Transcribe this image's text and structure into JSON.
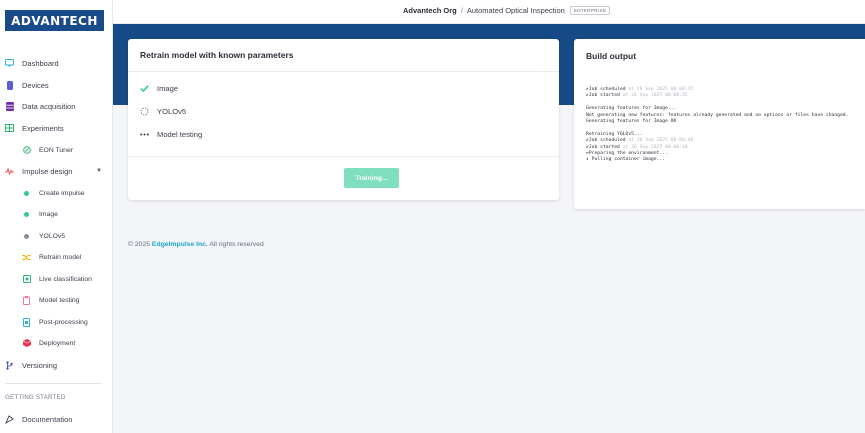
{
  "logo": {
    "text": "ADVANTECH"
  },
  "sidebar": {
    "items": [
      {
        "label": "Dashboard",
        "icon": "monitor-icon",
        "color": "#28b3d4"
      },
      {
        "label": "Devices",
        "icon": "device-icon",
        "color": "#5b5fd6"
      },
      {
        "label": "Data acquisition",
        "icon": "database-icon",
        "color": "#6a2ea8"
      },
      {
        "label": "Experiments",
        "icon": "grid-icon",
        "color": "#2fb47a"
      },
      {
        "label": "EON Tuner",
        "icon": "tuner-icon",
        "color": "#2fb47a"
      },
      {
        "label": "Impulse design",
        "icon": "pulse-icon",
        "color": "#e8534a"
      },
      {
        "label": "Create impulse",
        "icon": "dot-icon",
        "color": "#2ecc8e"
      },
      {
        "label": "Image",
        "icon": "dot-icon",
        "color": "#2ecc8e"
      },
      {
        "label": "YOLOv5",
        "icon": "dot-icon",
        "color": "#8b8c99"
      },
      {
        "label": "Retrain model",
        "icon": "shuffle-icon",
        "color": "#f2b705"
      },
      {
        "label": "Live classification",
        "icon": "live-icon",
        "color": "#2fb47a"
      },
      {
        "label": "Model testing",
        "icon": "clipboard-icon",
        "color": "#e87a9a"
      },
      {
        "label": "Post-processing",
        "icon": "postprocess-icon",
        "color": "#28b3d4"
      },
      {
        "label": "Deployment",
        "icon": "box-icon",
        "color": "#e8334a"
      },
      {
        "label": "Versioning",
        "icon": "branch-icon",
        "color": "#4a55c8"
      }
    ],
    "section_getting_started": "GETTING STARTED",
    "documentation": "Documentation"
  },
  "topbar": {
    "org": "Advantech Org",
    "separator": "/",
    "project": "Automated Optical Inspection",
    "badge": "ENTERPRISE"
  },
  "retrain_card": {
    "title": "Retrain model with known parameters",
    "steps": [
      {
        "label": "Image",
        "status": "done",
        "icon": "check-icon"
      },
      {
        "label": "YOLOv5",
        "status": "running",
        "icon": "spinner-icon"
      },
      {
        "label": "Model testing",
        "status": "pending",
        "icon": "ellipsis-icon"
      }
    ],
    "button_label": "Training..."
  },
  "build_output": {
    "title": "Build output",
    "lines": [
      {
        "text": "Job scheduled",
        "meta": " at 26 Sep 2025 00:00:35"
      },
      {
        "text": "Job started",
        "meta": " at 26 Sep 2025 00:00:35"
      },
      {
        "text": "",
        "meta": ""
      },
      {
        "text": "Generating features for Image...",
        "meta": ""
      },
      {
        "text": "Not generating new features: features already generated and no options or files have changed.",
        "meta": ""
      },
      {
        "text": "Generating features for Image OK",
        "meta": ""
      },
      {
        "text": "",
        "meta": ""
      },
      {
        "text": "Retraining YOLOv5...",
        "meta": ""
      },
      {
        "text": "Job scheduled",
        "meta": " at 26 Sep 2025 00:00:40"
      },
      {
        "text": "Job started",
        "meta": " at 26 Sep 2025 00:00:40"
      },
      {
        "text": "Preparing the environment...",
        "meta": ""
      },
      {
        "text": "Pulling container image...",
        "meta": ""
      }
    ]
  },
  "footer": {
    "copyright": "© 2025",
    "brand": "EdgeImpulse Inc.",
    "rights": "All rights reserved"
  },
  "colors": {
    "band": "#154a86",
    "accent": "#2ecc8e",
    "button": "#7fdfbe",
    "footer_link": "#1aa6c9"
  }
}
